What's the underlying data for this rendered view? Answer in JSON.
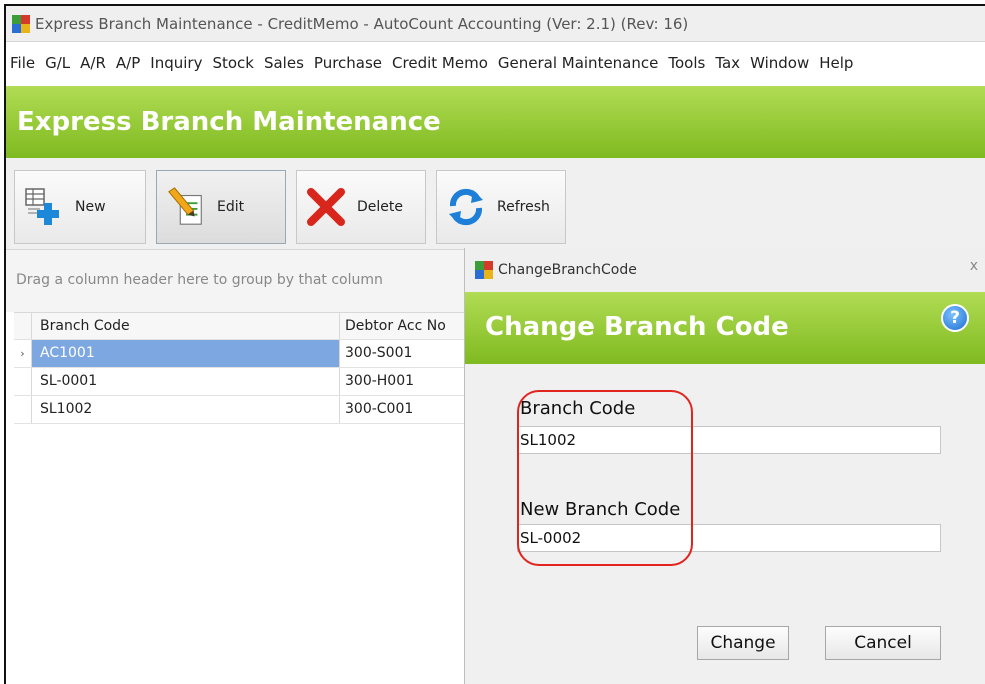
{
  "window": {
    "title": "Express Branch Maintenance - CreditMemo - AutoCount Accounting (Ver: 2.1) (Rev: 16)"
  },
  "menu": [
    "File",
    "G/L",
    "A/R",
    "A/P",
    "Inquiry",
    "Stock",
    "Sales",
    "Purchase",
    "Credit Memo",
    "General Maintenance",
    "Tools",
    "Tax",
    "Window",
    "Help"
  ],
  "banner": {
    "title": "Express Branch Maintenance"
  },
  "toolbar": {
    "new_label": "New",
    "edit_label": "Edit",
    "delete_label": "Delete",
    "refresh_label": "Refresh"
  },
  "grid": {
    "group_hint": "Drag a column header here to group by that column",
    "columns": [
      "Branch Code",
      "Debtor Acc No"
    ],
    "rows": [
      {
        "indicator": "›",
        "branch_code": "AC1001",
        "debtor": "300-S001"
      },
      {
        "indicator": "",
        "branch_code": "SL-0001",
        "debtor": "300-H001"
      },
      {
        "indicator": "",
        "branch_code": "SL1002",
        "debtor": "300-C001"
      }
    ]
  },
  "dialog": {
    "title": "ChangeBranchCode",
    "close": "x",
    "heading": "Change Branch Code",
    "help": "?",
    "branch_code_label": "Branch Code",
    "branch_code_value": "SL1002",
    "new_branch_code_label": "New Branch Code",
    "new_branch_code_value": "SL-0002",
    "change_label": "Change",
    "cancel_label": "Cancel"
  },
  "colors": {
    "banner_green": "#8cc63f",
    "selection_blue": "#7da7e0",
    "highlight_red": "#e0251f"
  }
}
